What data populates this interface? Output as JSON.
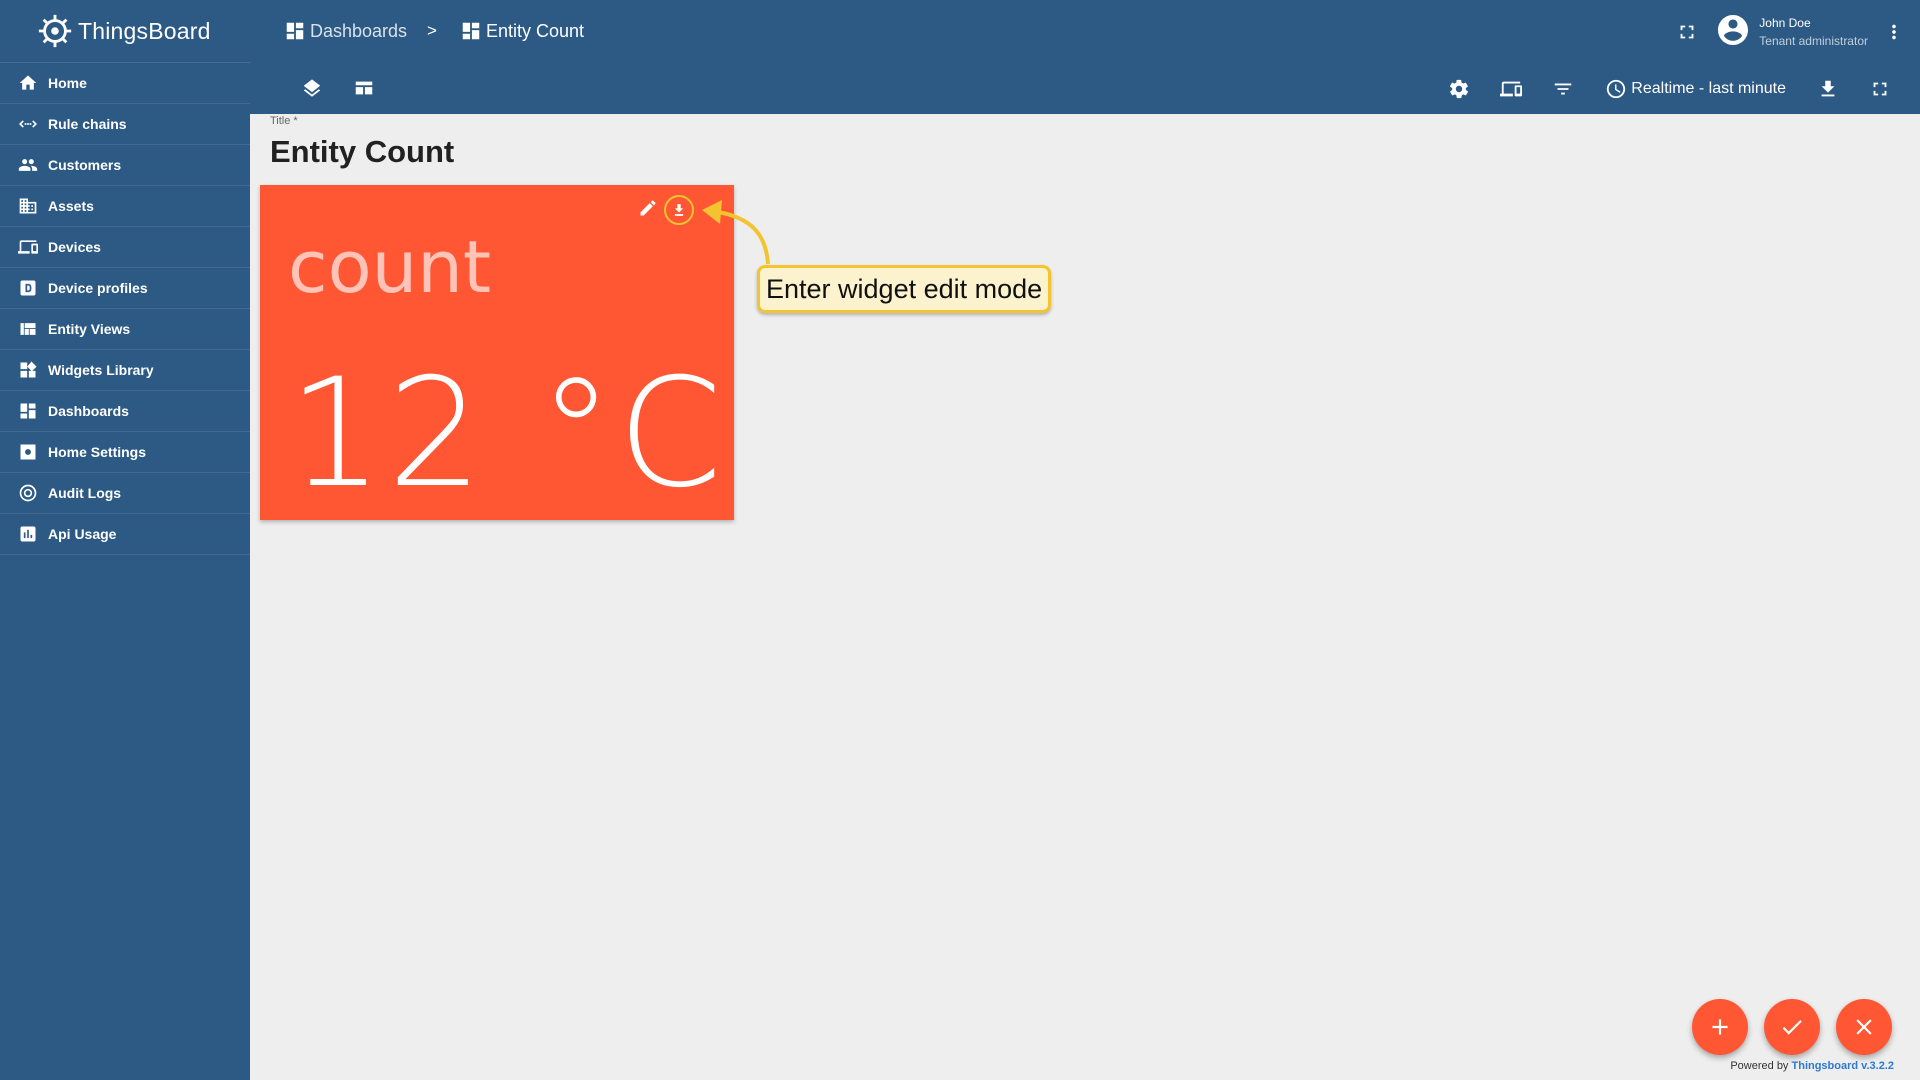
{
  "brand": {
    "name": "ThingsBoard",
    "logo_icon": "thingsboard-logo-icon"
  },
  "sidebar": {
    "items": [
      {
        "label": "Home",
        "icon": "home-icon"
      },
      {
        "label": "Rule chains",
        "icon": "rule-chains-icon"
      },
      {
        "label": "Customers",
        "icon": "customers-icon"
      },
      {
        "label": "Assets",
        "icon": "assets-icon"
      },
      {
        "label": "Devices",
        "icon": "devices-icon"
      },
      {
        "label": "Device profiles",
        "icon": "device-profiles-icon"
      },
      {
        "label": "Entity Views",
        "icon": "entity-views-icon"
      },
      {
        "label": "Widgets Library",
        "icon": "widgets-library-icon"
      },
      {
        "label": "Dashboards",
        "icon": "dashboards-icon"
      },
      {
        "label": "Home Settings",
        "icon": "settings-icon"
      },
      {
        "label": "Audit Logs",
        "icon": "audit-logs-icon"
      },
      {
        "label": "Api Usage",
        "icon": "api-usage-icon"
      }
    ]
  },
  "breadcrumb": {
    "parent": "Dashboards",
    "separator": ">",
    "current": "Entity Count"
  },
  "user": {
    "name": "John Doe",
    "role": "Tenant administrator"
  },
  "toolbar": {
    "timewindow": "Realtime - last minute"
  },
  "dashboard": {
    "title_label": "Title *",
    "title_value": "Entity Count"
  },
  "widget": {
    "title": "count",
    "value": "12 °C",
    "background": "#ff5733"
  },
  "tooltip": {
    "text": "Enter widget edit mode"
  },
  "footer": {
    "powered_by": "Powered by",
    "version_link": "Thingsboard v.3.2.2"
  },
  "colors": {
    "primary": "#2c5a84",
    "accent": "#ff5733",
    "highlight": "#f4c430",
    "tooltip_bg": "#fcf2cd"
  }
}
